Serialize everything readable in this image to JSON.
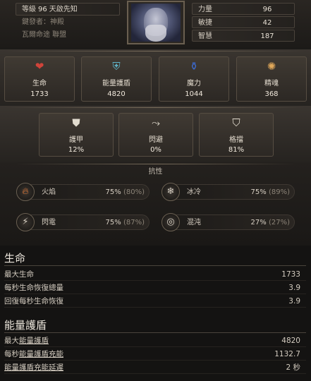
{
  "header": {
    "level_prefix": "等級",
    "level": "96",
    "class_name": "天啟先知",
    "subclass": "鍵發者：神殿",
    "faction": "瓦爾命途 聯盟",
    "attributes": [
      {
        "name": "力量",
        "value": "96"
      },
      {
        "name": "敏捷",
        "value": "42"
      },
      {
        "name": "智慧",
        "value": "187"
      }
    ]
  },
  "stats_top": [
    {
      "label": "生命",
      "value": "1733",
      "icon": "heart-icon"
    },
    {
      "label": "能量護盾",
      "value": "4820",
      "icon": "energy-shield-icon"
    },
    {
      "label": "魔力",
      "value": "1044",
      "icon": "mana-potion-icon"
    },
    {
      "label": "精魂",
      "value": "368",
      "icon": "spirit-icon"
    }
  ],
  "stats_defense": [
    {
      "label": "護甲",
      "value": "12%",
      "icon": "armour-icon"
    },
    {
      "label": "閃避",
      "value": "0%",
      "icon": "evasion-icon"
    },
    {
      "label": "格擋",
      "value": "81%",
      "icon": "block-shield-icon"
    }
  ],
  "resistances": {
    "title": "抗性",
    "items": [
      {
        "name": "火焰",
        "value": "75%",
        "max": "(80%)",
        "icon": "fire-icon"
      },
      {
        "name": "冰冷",
        "value": "75%",
        "max": "(89%)",
        "icon": "cold-icon"
      },
      {
        "name": "閃電",
        "value": "75%",
        "max": "(87%)",
        "icon": "lightning-icon"
      },
      {
        "name": "混沌",
        "value": "27%",
        "max": "(27%)",
        "icon": "chaos-icon"
      }
    ]
  },
  "life_section": {
    "title": "生命",
    "rows": [
      {
        "label": "最大生命",
        "value": "1733"
      },
      {
        "label": "每秒生命恢復總量",
        "value": "3.9"
      },
      {
        "label": "回復每秒生命恢復",
        "value": "3.9"
      }
    ]
  },
  "es_section": {
    "title": "能量護盾",
    "rows": [
      {
        "label_pre": "最大",
        "label_u": "能量護盾",
        "label_post": "",
        "value": "4820"
      },
      {
        "label_pre": "每秒",
        "label_u": "能量護盾充能",
        "label_post": "",
        "value": "1132.7"
      },
      {
        "label_pre": "",
        "label_u": "能量護盾充能延遲",
        "label_post": "",
        "value": "2 秒"
      }
    ]
  },
  "colors": {
    "background": "#151312",
    "panel": "#2c2824",
    "text": "#d8d0c4",
    "life_icon": "#c0392b",
    "es_icon": "#5fb4c9",
    "mana_icon": "#3d6bd1",
    "spirit_icon": "#e0a85a"
  }
}
